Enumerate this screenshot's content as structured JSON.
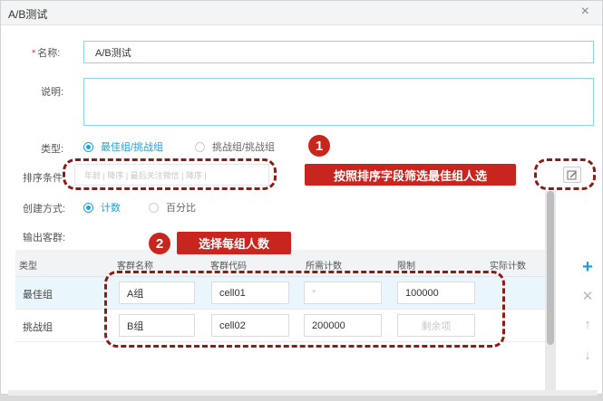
{
  "window": {
    "title": "A/B测试",
    "close_icon": "×"
  },
  "form": {
    "name_label": "名称:",
    "name_value": "A/B测试",
    "desc_label": "说明:",
    "type_label": "类型:",
    "type_options": [
      {
        "label": "最佳组/挑战组",
        "selected": true
      },
      {
        "label": "挑战组/挑战组",
        "selected": false
      }
    ],
    "sort_label": "排序条件:",
    "sort_placeholder": "年龄 | 降序 | 最后关注微信 | 降序 |",
    "create_label": "创建方式:",
    "create_options": [
      {
        "label": "计数",
        "selected": true
      },
      {
        "label": "百分比",
        "selected": false
      }
    ],
    "output_label": "输出客群:"
  },
  "annotations": {
    "badge1": "1",
    "callout1": "按照排序字段筛选最佳组人选",
    "badge2": "2",
    "callout2": "选择每组人数"
  },
  "table": {
    "headers": [
      "类型",
      "客群名称",
      "客群代码",
      "所需计数",
      "限制",
      "实际计数"
    ],
    "rows": [
      {
        "type": "最佳组",
        "name": "A组",
        "code": "cell01",
        "count": "*",
        "limit": "100000",
        "actual": ""
      },
      {
        "type": "挑战组",
        "name": "B组",
        "code": "cell02",
        "count": "200000",
        "limit": "剩余项",
        "actual": ""
      }
    ]
  },
  "side_icons": {
    "add": "+",
    "remove": "✕",
    "up": "↑",
    "down": "↓"
  },
  "colors": {
    "accent": "#1ea1d8",
    "callout": "#c8251e",
    "dashed": "#8b1c16",
    "required": "#e0393e",
    "add": "#1ea1d8"
  }
}
